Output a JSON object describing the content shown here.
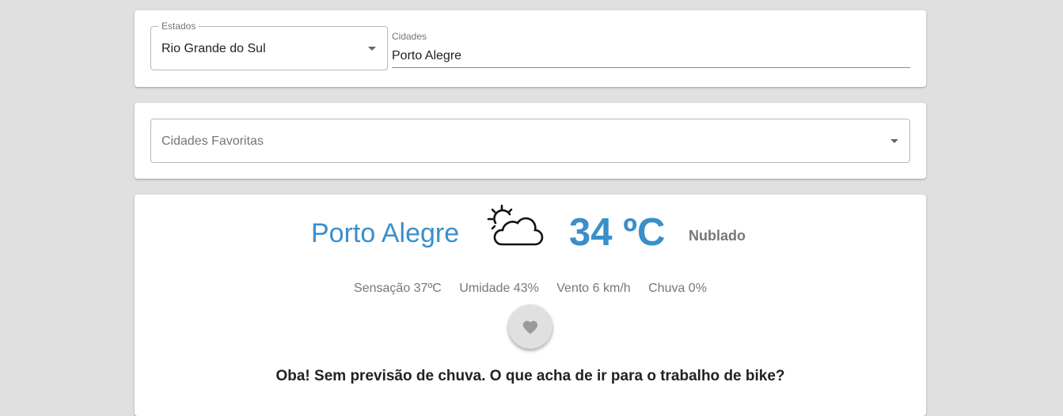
{
  "search": {
    "estado_label": "Estados",
    "estado_value": "Rio Grande do Sul",
    "cidade_label": "Cidades",
    "cidade_value": "Porto Alegre"
  },
  "favorites": {
    "placeholder": "Cidades Favoritas"
  },
  "weather": {
    "city": "Porto Alegre",
    "icon": "partly-cloudy-sun-icon",
    "temperature": "34 ºC",
    "condition": "Nublado",
    "details": {
      "sensacao": "Sensação 37ºC",
      "umidade": "Umidade 43%",
      "vento": "Vento 6 km/h",
      "chuva": "Chuva 0%"
    },
    "message": "Oba! Sem previsão de chuva. O que acha de ir para o trabalho de bike?"
  },
  "colors": {
    "accent": "#3a8fca",
    "background": "#e0e0e0"
  }
}
